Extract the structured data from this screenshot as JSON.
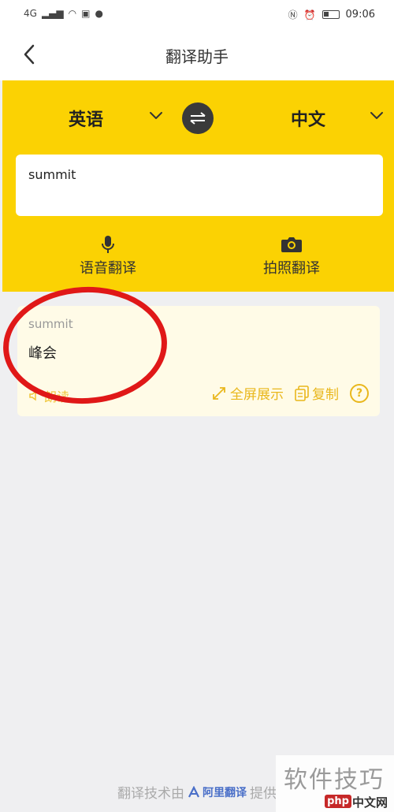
{
  "status_bar": {
    "network": "4G",
    "time": "09:06"
  },
  "title_bar": {
    "title": "翻译助手"
  },
  "language_bar": {
    "source_lang": "英语",
    "target_lang": "中文"
  },
  "input": {
    "value": "summit"
  },
  "actions": {
    "voice_label": "语音翻译",
    "photo_label": "拍照翻译"
  },
  "result": {
    "source_text": "summit",
    "translated_text": "峰会",
    "read_label": "朗读",
    "fullscreen_label": "全屏展示",
    "copy_label": "复制",
    "help_label": "?"
  },
  "footer": {
    "text_before": "翻译技术由",
    "logo_text": "阿里翻译",
    "text_after": "提供"
  },
  "watermark": {
    "text": "软件技巧",
    "php_badge": "php",
    "site": "中文网"
  },
  "colors": {
    "accent_yellow": "#fbd203",
    "annotation_red": "#e01818",
    "tool_gold": "#e9b71c"
  }
}
